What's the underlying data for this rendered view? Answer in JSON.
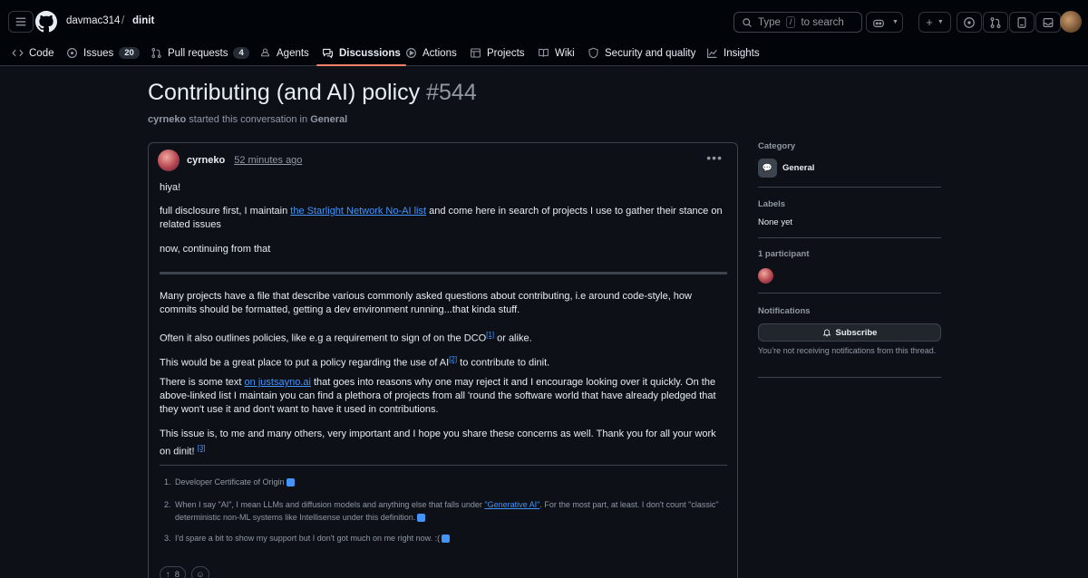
{
  "header": {
    "owner": "davmac314",
    "separator": "/",
    "repo": "dinit",
    "search_label": "Type",
    "search_key": "/",
    "search_suffix": "to search"
  },
  "tabs": [
    {
      "label": "Code",
      "icon": "code-icon"
    },
    {
      "label": "Issues",
      "count": "20",
      "icon": "issue-icon"
    },
    {
      "label": "Pull requests",
      "count": "4",
      "icon": "pull-request-icon"
    },
    {
      "label": "Agents",
      "icon": "agents-icon"
    },
    {
      "label": "Discussions",
      "icon": "discussion-icon",
      "selected": true
    },
    {
      "label": "Actions",
      "icon": "play-icon"
    },
    {
      "label": "Projects",
      "icon": "table-icon"
    },
    {
      "label": "Wiki",
      "icon": "book-icon"
    },
    {
      "label": "Security and quality",
      "icon": "shield-icon"
    },
    {
      "label": "Insights",
      "icon": "graph-icon"
    }
  ],
  "discussion": {
    "title": "Contributing (and AI) policy",
    "number": "#544",
    "author": "cyrneko",
    "byline_mid": "started this conversation in",
    "category": "General"
  },
  "post": {
    "author": "cyrneko",
    "time": "52 minutes ago",
    "p1": "hiya!",
    "p2_pre": "full disclosure first, I maintain ",
    "p2_link": "the Starlight Network No-AI list",
    "p2_post": " and come here in search of projects I use to gather their stance on related issues",
    "p3": "now, continuing from that",
    "p4": "Many projects have a file that describe various commonly asked questions about contributing, i.e around code-style, how commits should be formatted, getting a dev environment running...that kinda stuff.",
    "p5_pre": "Often it also outlines policies, like e.g a requirement to sign of on the DCO",
    "p5_sup": "[1]",
    "p5_post": " or alike.",
    "p6_pre": "This would be a great place to put a policy regarding the use of AI",
    "p6_sup": "[2]",
    "p6_post": " to contribute to dinit.",
    "p7_pre": "There is some text ",
    "p7_link": "on justsayno.ai",
    "p7_post": " that goes into reasons why one may reject it and I encourage looking over it quickly. On the above-linked list I maintain you can find a plethora of projects from all 'round the software world that have already pledged that they won't use it and don't want to have it used in contributions.",
    "p8": "This issue is, to me and many others, very important and I hope you share these concerns as well. Thank you for all your work on dinit!",
    "p8_sup": "[3]",
    "fn1": "Developer Certificate of Origin",
    "fn2_pre": "When I say \"AI\", I mean LLMs and diffusion models and anything else that falls under ",
    "fn2_link": "\"Generative AI\"",
    "fn2_post": ". For the most part, at least. I don't count \"classic\" deterministic non-ML systems like Intellisense under this definition.",
    "fn3": "I'd spare a bit to show my support but I don't got much on me right now. :(",
    "upvotes": "8"
  },
  "sidebar": {
    "category_heading": "Category",
    "category": "General",
    "labels_heading": "Labels",
    "labels": "None yet",
    "participants_heading": "1 participant",
    "notifications_heading": "Notifications",
    "subscribe": "Subscribe",
    "notif_note": "You’re not receiving notifications from this thread."
  },
  "colors": {
    "accent": "#f78166",
    "link": "#4493f8",
    "bg": "#0d1117"
  }
}
